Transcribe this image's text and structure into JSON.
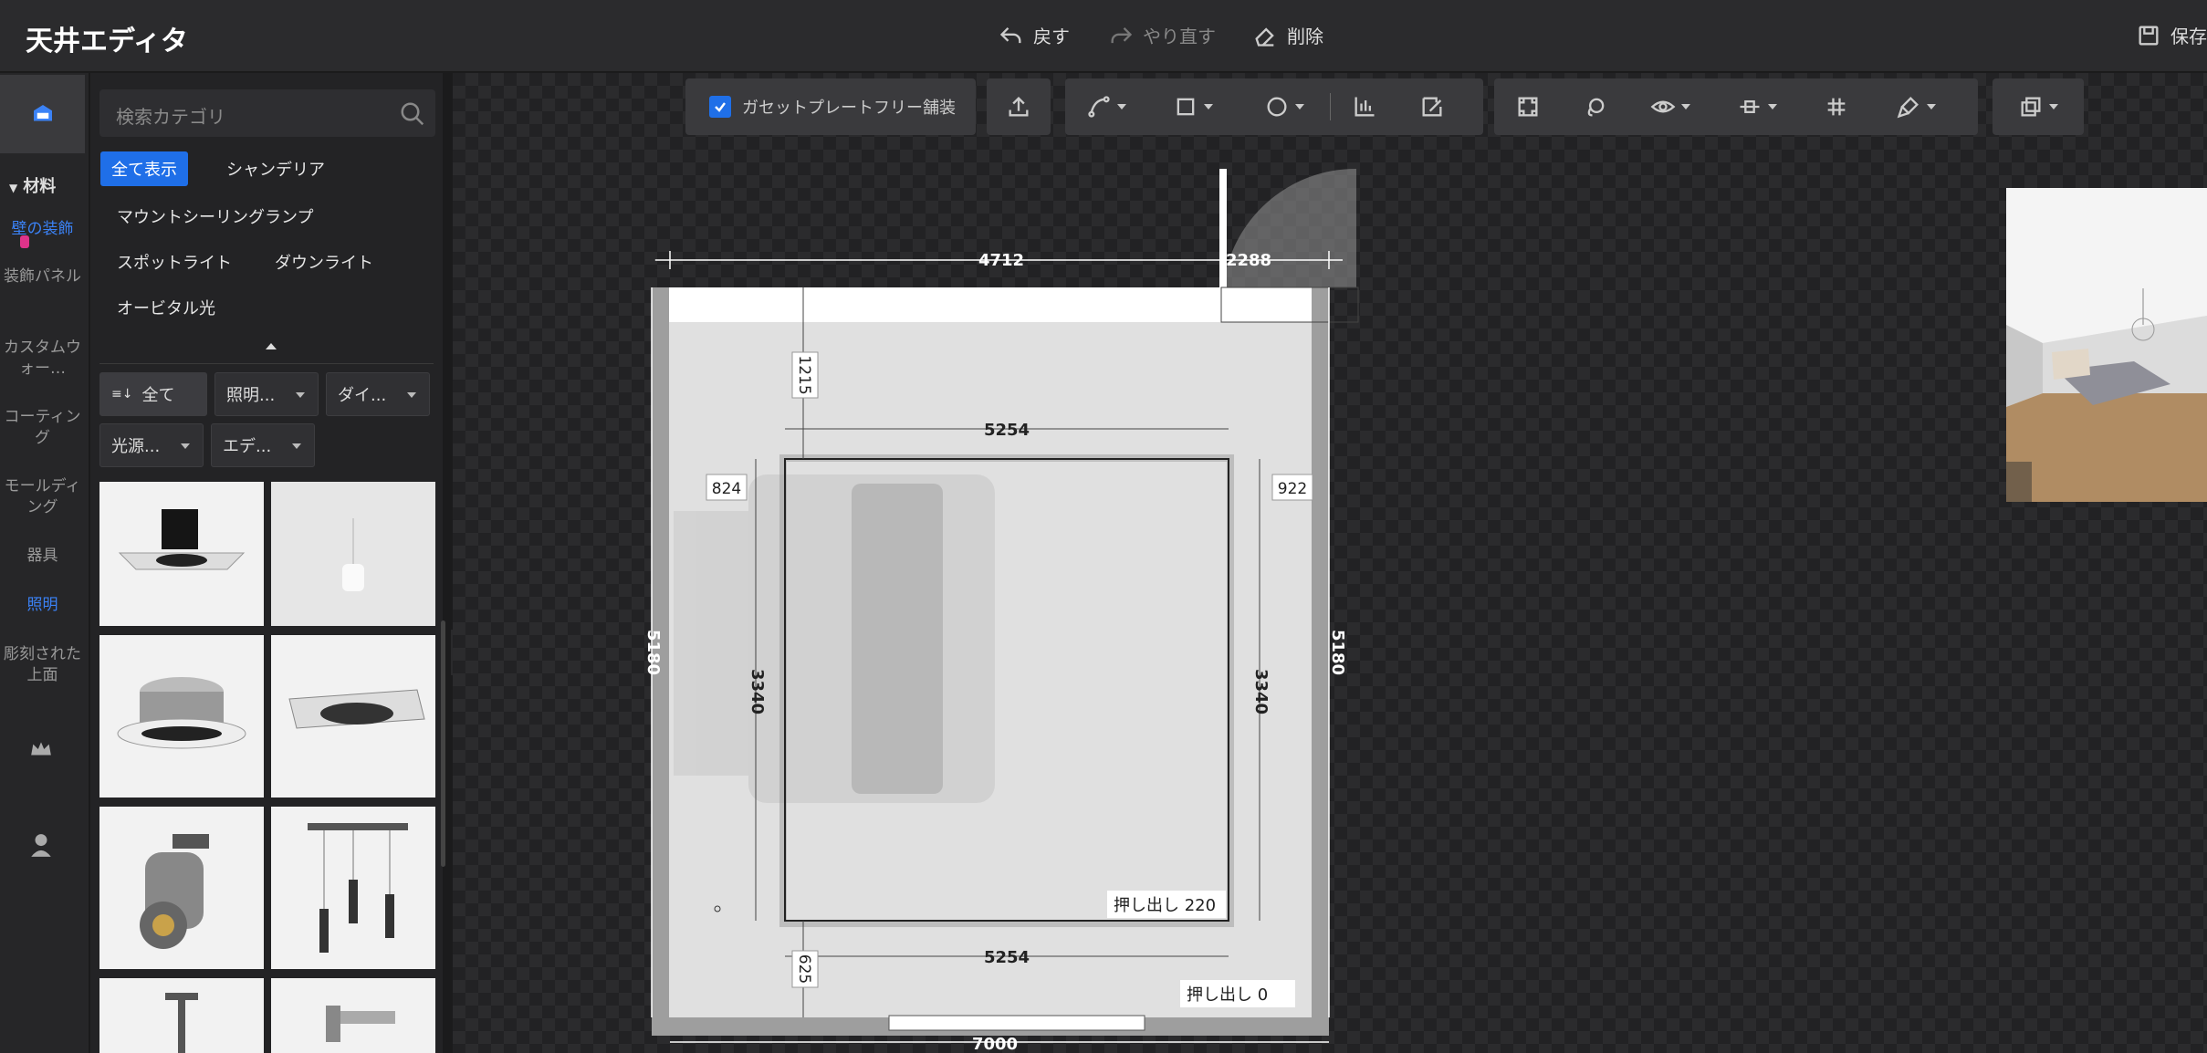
{
  "header": {
    "title": "天井エディタ",
    "undo": "戻す",
    "redo": "やり直す",
    "delete": "削除",
    "save": "保存"
  },
  "rail": {
    "section": "材料",
    "items": [
      {
        "label": "壁の装飾",
        "active": false
      },
      {
        "label": "装飾パネル",
        "active": false
      },
      {
        "label": "カスタムウォー…",
        "active": false
      },
      {
        "label": "コーティング",
        "active": false
      },
      {
        "label": "モールディング",
        "active": false
      },
      {
        "label": "器具",
        "active": false
      },
      {
        "label": "照明",
        "active": true
      },
      {
        "label": "彫刻された上面",
        "active": false
      }
    ]
  },
  "panel": {
    "search_placeholder": "検索カテゴリ",
    "categories": [
      {
        "label": "全て表示",
        "selected": true
      },
      {
        "label": "シャンデリア"
      },
      {
        "label": "マウントシーリングランプ"
      },
      {
        "label": "スポットライト"
      },
      {
        "label": "ダウンライト"
      },
      {
        "label": "オービタル光"
      }
    ],
    "filters": [
      "全て",
      "照明...",
      "ダイ...",
      "光源...",
      "エデ..."
    ]
  },
  "toolbar": {
    "gusset_label": "ガセットプレートフリー舗装"
  },
  "plan": {
    "dimensions": {
      "top_left": "4712",
      "top_right": "2288",
      "left_height": "5180",
      "right_height": "5180",
      "offset_top": "1215",
      "offset_bottom": "625",
      "offset_left": "824",
      "offset_right": "922",
      "inner_width_top": "5254",
      "inner_width_bottom": "5254",
      "inner_height_left": "3340",
      "inner_height_right": "3340",
      "total_width": "7000"
    },
    "extrude_inner": "押し出し  220",
    "extrude_outer": "押し出し  0"
  },
  "colors": {
    "accent": "#1f6fe8",
    "active_text": "#3b82f6"
  }
}
